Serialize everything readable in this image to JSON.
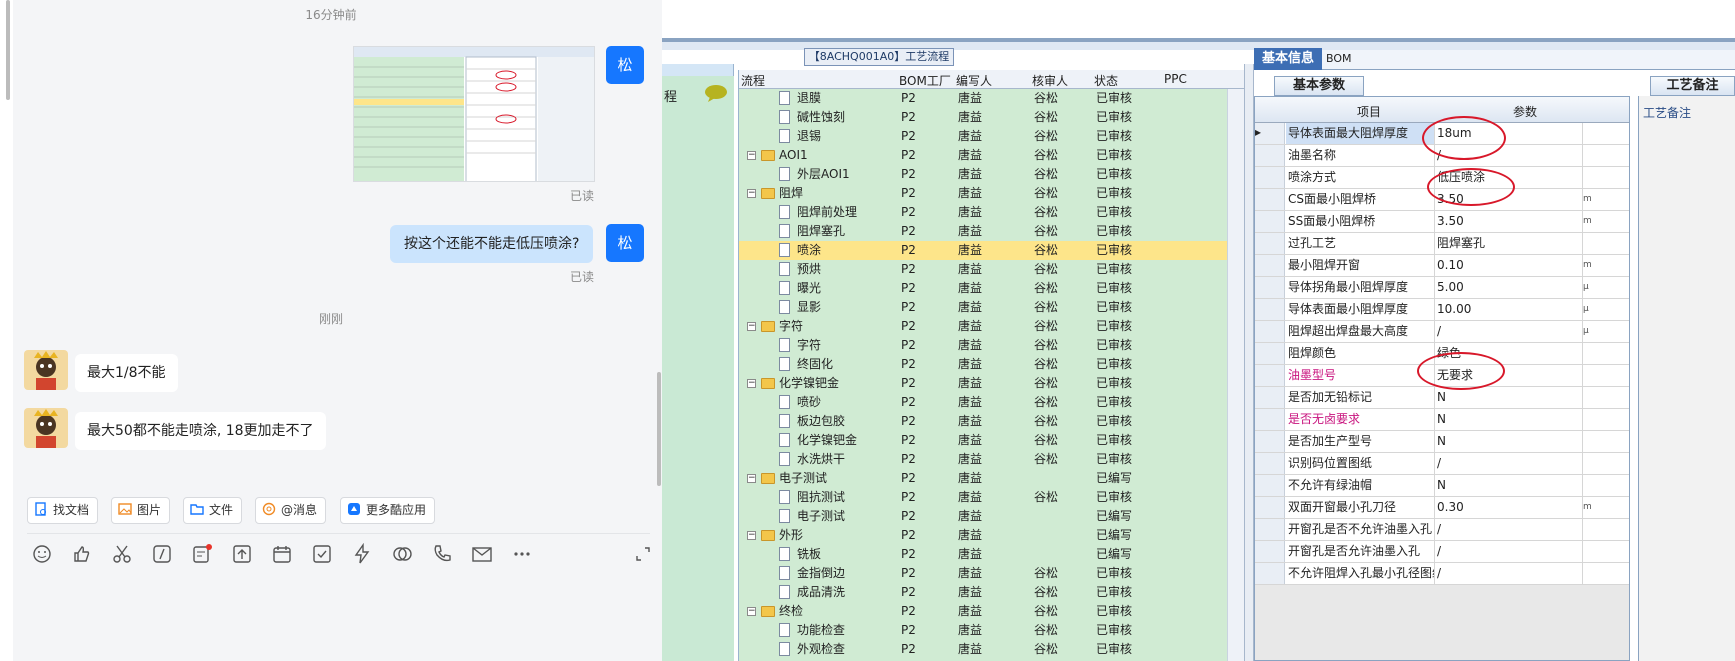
{
  "chat": {
    "timestamp_top": "16分钟前",
    "me_avatar_text": "松",
    "read_1": "已读",
    "my_message": "按这个还能不能走低压喷涂?",
    "read_2": "已读",
    "timestamp_just_now": "刚刚",
    "other_msg_1": "最大1/8不能",
    "other_msg_2": "最大50都不能走喷涂, 18更加走不了",
    "toolbar": [
      {
        "label": "找文档",
        "icon": "doc-search-icon"
      },
      {
        "label": "图片",
        "icon": "image-icon"
      },
      {
        "label": "文件",
        "icon": "folder-icon"
      },
      {
        "label": "@消息",
        "icon": "at-icon"
      },
      {
        "label": "更多酷应用",
        "icon": "apps-icon"
      }
    ]
  },
  "erp": {
    "flow_title": "【8ACHQ001A0】工艺流程",
    "left_label": "程",
    "tree_headers": {
      "flow": "流程",
      "bom": "BOM工厂",
      "writer": "编写人",
      "reviewer": "核审人",
      "status": "状态",
      "ppc": "PPC"
    },
    "tree_rows": [
      {
        "name": "退膜",
        "type": "doc",
        "bom": "P2",
        "writer": "唐益",
        "reviewer": "谷松",
        "status": "已审核"
      },
      {
        "name": "碱性蚀刻",
        "type": "doc",
        "bom": "P2",
        "writer": "唐益",
        "reviewer": "谷松",
        "status": "已审核"
      },
      {
        "name": "退锡",
        "type": "doc",
        "bom": "P2",
        "writer": "唐益",
        "reviewer": "谷松",
        "status": "已审核"
      },
      {
        "name": "AOI1",
        "type": "folder",
        "bom": "P2",
        "writer": "唐益",
        "reviewer": "谷松",
        "status": "已审核"
      },
      {
        "name": "外层AOI1",
        "type": "doc",
        "bom": "P2",
        "writer": "唐益",
        "reviewer": "谷松",
        "status": "已审核"
      },
      {
        "name": "阻焊",
        "type": "folder",
        "bom": "P2",
        "writer": "唐益",
        "reviewer": "谷松",
        "status": "已审核"
      },
      {
        "name": "阻焊前处理",
        "type": "doc",
        "bom": "P2",
        "writer": "唐益",
        "reviewer": "谷松",
        "status": "已审核"
      },
      {
        "name": "阻焊塞孔",
        "type": "doc",
        "bom": "P2",
        "writer": "唐益",
        "reviewer": "谷松",
        "status": "已审核"
      },
      {
        "name": "喷涂",
        "type": "doc",
        "bom": "P2",
        "writer": "唐益",
        "reviewer": "谷松",
        "status": "已审核",
        "selected": true
      },
      {
        "name": "预烘",
        "type": "doc",
        "bom": "P2",
        "writer": "唐益",
        "reviewer": "谷松",
        "status": "已审核"
      },
      {
        "name": "曝光",
        "type": "doc",
        "bom": "P2",
        "writer": "唐益",
        "reviewer": "谷松",
        "status": "已审核"
      },
      {
        "name": "显影",
        "type": "doc",
        "bom": "P2",
        "writer": "唐益",
        "reviewer": "谷松",
        "status": "已审核"
      },
      {
        "name": "字符",
        "type": "folder",
        "bom": "P2",
        "writer": "唐益",
        "reviewer": "谷松",
        "status": "已审核"
      },
      {
        "name": "字符",
        "type": "doc",
        "bom": "P2",
        "writer": "唐益",
        "reviewer": "谷松",
        "status": "已审核"
      },
      {
        "name": "终固化",
        "type": "doc",
        "bom": "P2",
        "writer": "唐益",
        "reviewer": "谷松",
        "status": "已审核"
      },
      {
        "name": "化学镍钯金",
        "type": "folder",
        "bom": "P2",
        "writer": "唐益",
        "reviewer": "谷松",
        "status": "已审核"
      },
      {
        "name": "喷砂",
        "type": "doc",
        "bom": "P2",
        "writer": "唐益",
        "reviewer": "谷松",
        "status": "已审核"
      },
      {
        "name": "板边包胶",
        "type": "doc",
        "bom": "P2",
        "writer": "唐益",
        "reviewer": "谷松",
        "status": "已审核"
      },
      {
        "name": "化学镍钯金",
        "type": "doc",
        "bom": "P2",
        "writer": "唐益",
        "reviewer": "谷松",
        "status": "已审核"
      },
      {
        "name": "水洗烘干",
        "type": "doc",
        "bom": "P2",
        "writer": "唐益",
        "reviewer": "谷松",
        "status": "已审核"
      },
      {
        "name": "电子测试",
        "type": "folder",
        "bom": "P2",
        "writer": "唐益",
        "reviewer": "",
        "status": "已编写"
      },
      {
        "name": "阻抗测试",
        "type": "doc",
        "bom": "P2",
        "writer": "唐益",
        "reviewer": "谷松",
        "status": "已审核"
      },
      {
        "name": "电子测试",
        "type": "doc",
        "bom": "P2",
        "writer": "唐益",
        "reviewer": "",
        "status": "已编写"
      },
      {
        "name": "外形",
        "type": "folder",
        "bom": "P2",
        "writer": "唐益",
        "reviewer": "",
        "status": "已编写"
      },
      {
        "name": "铣板",
        "type": "doc",
        "bom": "P2",
        "writer": "唐益",
        "reviewer": "",
        "status": "已编写"
      },
      {
        "name": "金指倒边",
        "type": "doc",
        "bom": "P2",
        "writer": "唐益",
        "reviewer": "谷松",
        "status": "已审核"
      },
      {
        "name": "成品清洗",
        "type": "doc",
        "bom": "P2",
        "writer": "唐益",
        "reviewer": "谷松",
        "status": "已审核"
      },
      {
        "name": "终检",
        "type": "folder",
        "bom": "P2",
        "writer": "唐益",
        "reviewer": "谷松",
        "status": "已审核"
      },
      {
        "name": "功能检查",
        "type": "doc",
        "bom": "P2",
        "writer": "唐益",
        "reviewer": "谷松",
        "status": "已审核"
      },
      {
        "name": "外观检查",
        "type": "doc",
        "bom": "P2",
        "writer": "唐益",
        "reviewer": "谷松",
        "status": "已审核"
      }
    ],
    "tab_basic": "基本信息",
    "tab_bom": "BOM",
    "subtab_params": "基本参数",
    "subtab_remark": "工艺备注",
    "remark_label": "工艺备注",
    "grid_headers": {
      "item": "项目",
      "param": "参数"
    },
    "params": [
      {
        "k": "导体表面最大阻焊厚度",
        "v": "18um",
        "u": ""
      },
      {
        "k": "油墨名称",
        "v": "/",
        "u": ""
      },
      {
        "k": "喷涂方式",
        "v": "低压喷涂",
        "u": ""
      },
      {
        "k": "CS面最小阻焊桥",
        "v": "3.50",
        "u": "m"
      },
      {
        "k": "SS面最小阻焊桥",
        "v": "3.50",
        "u": "m"
      },
      {
        "k": "过孔工艺",
        "v": "阻焊塞孔",
        "u": ""
      },
      {
        "k": "最小阻焊开窗",
        "v": "0.10",
        "u": "m"
      },
      {
        "k": "导体拐角最小阻焊厚度",
        "v": "5.00",
        "u": "μ"
      },
      {
        "k": "导体表面最小阻焊厚度",
        "v": "10.00",
        "u": "μ"
      },
      {
        "k": "阻焊超出焊盘最大高度",
        "v": "/",
        "u": "μ"
      },
      {
        "k": "阻焊颜色",
        "v": "绿色",
        "u": ""
      },
      {
        "k": "油墨型号",
        "v": "无要求",
        "u": "",
        "magenta": true
      },
      {
        "k": "是否加无铅标记",
        "v": "N",
        "u": ""
      },
      {
        "k": "是否无卤要求",
        "v": "N",
        "u": "",
        "magenta": true
      },
      {
        "k": "是否加生产型号",
        "v": "N",
        "u": ""
      },
      {
        "k": "识别码位置图纸",
        "v": "/",
        "u": ""
      },
      {
        "k": "不允许有绿油帽",
        "v": "N",
        "u": ""
      },
      {
        "k": "双面开窗最小孔刀径",
        "v": "0.30",
        "u": "m"
      },
      {
        "k": "开窗孔是否不允许油墨入孔",
        "v": "/",
        "u": ""
      },
      {
        "k": "开窗孔是否允许油墨入孔",
        "v": "/",
        "u": ""
      },
      {
        "k": "不允许阻焊入孔最小孔径图纸",
        "v": "/",
        "u": ""
      }
    ]
  }
}
